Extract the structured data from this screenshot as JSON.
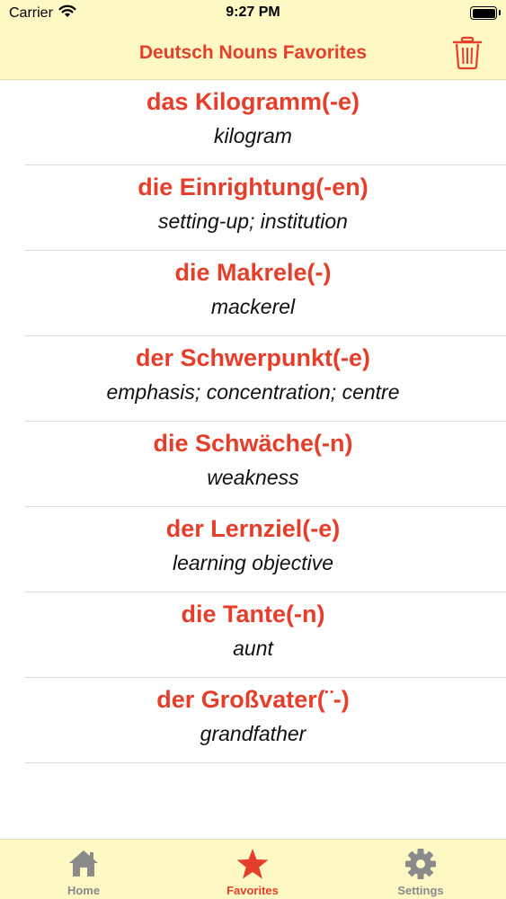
{
  "status_bar": {
    "carrier": "Carrier",
    "time": "9:27 PM"
  },
  "nav": {
    "title": "Deutsch Nouns Favorites",
    "trash_icon": "trash-icon"
  },
  "favorites": [
    {
      "term": "das Kilogramm(-e)",
      "translation": "kilogram"
    },
    {
      "term": "die Einrightung(-en)",
      "translation": "setting-up; institution"
    },
    {
      "term": "die Makrele(-)",
      "translation": "mackerel"
    },
    {
      "term": "der Schwerpunkt(-e)",
      "translation": "emphasis; concentration; centre"
    },
    {
      "term": "die Schwäche(-n)",
      "translation": "weakness"
    },
    {
      "term": "der Lernziel(-e)",
      "translation": "learning objective"
    },
    {
      "term": "die Tante(-n)",
      "translation": "aunt"
    },
    {
      "term": "der Großvater(¨-)",
      "translation": "grandfather"
    }
  ],
  "tabs": [
    {
      "label": "Home",
      "icon": "home-icon"
    },
    {
      "label": "Favorites",
      "icon": "star-icon",
      "active": true
    },
    {
      "label": "Settings",
      "icon": "gear-icon"
    }
  ],
  "colors": {
    "accent": "#e53e2a",
    "bar_background": "#fdf8c4",
    "inactive_tab": "#8a8a8a"
  }
}
